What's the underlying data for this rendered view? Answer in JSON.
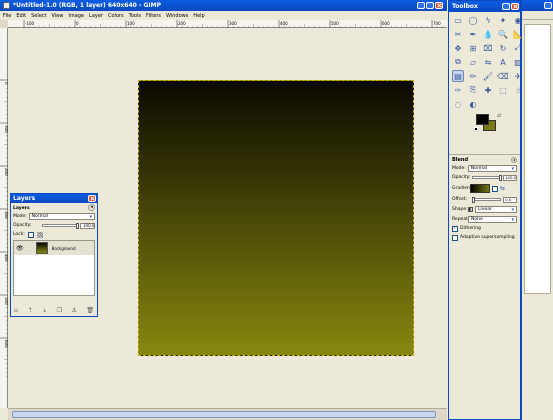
{
  "app": {
    "title": "*Untitled-1.0 (RGB, 1 layer) 640x640 - GIMP",
    "menu": [
      "File",
      "Edit",
      "Select",
      "View",
      "Image",
      "Layer",
      "Colors",
      "Tools",
      "Filters",
      "Windows",
      "Help"
    ]
  },
  "ruler": {
    "h_labels": [
      "-100",
      "0",
      "100",
      "200",
      "300",
      "400",
      "500",
      "600",
      "700"
    ],
    "v_labels": [
      "0",
      "100",
      "200",
      "300",
      "400",
      "500",
      "600"
    ]
  },
  "canvas": {
    "gradient_top": "#0a0900",
    "gradient_bottom": "#87870e",
    "background": "#ece9d8"
  },
  "layers": {
    "title": "Layers",
    "header": "Layers",
    "mode_label": "Mode:",
    "mode_value": "Normal",
    "opacity_label": "Opacity:",
    "opacity_value": "100.0",
    "lock_label": "Lock:",
    "layer_name": "Background"
  },
  "toolbox": {
    "title": "Toolbox",
    "tools": [
      "rect-select",
      "ellipse-select",
      "free-select",
      "fuzzy-select",
      "color-select",
      "scissors",
      "paths",
      "color-picker",
      "zoom",
      "measure",
      "move",
      "align",
      "crop",
      "rotate",
      "scale",
      "shear",
      "perspective",
      "flip",
      "text",
      "bucket-fill",
      "blend",
      "pencil",
      "paintbrush",
      "eraser",
      "airbrush",
      "ink",
      "clone",
      "heal",
      "perspective-clone",
      "smudge",
      "blur",
      "dodge"
    ],
    "fg_color": "#000000",
    "bg_color": "#7a7a12"
  },
  "blend": {
    "title": "Blend",
    "mode_label": "Mode:",
    "mode_value": "Normal",
    "opacity_label": "Opacity:",
    "opacity_value": "100.0",
    "gradient_label": "Gradient:",
    "offset_label": "Offset:",
    "offset_value": "0.0",
    "shape_label": "Shape:",
    "shape_value": "Linear",
    "repeat_label": "Repeat:",
    "repeat_value": "None",
    "dithering_label": "Dithering",
    "adaptive_label": "Adaptive supersampling"
  }
}
